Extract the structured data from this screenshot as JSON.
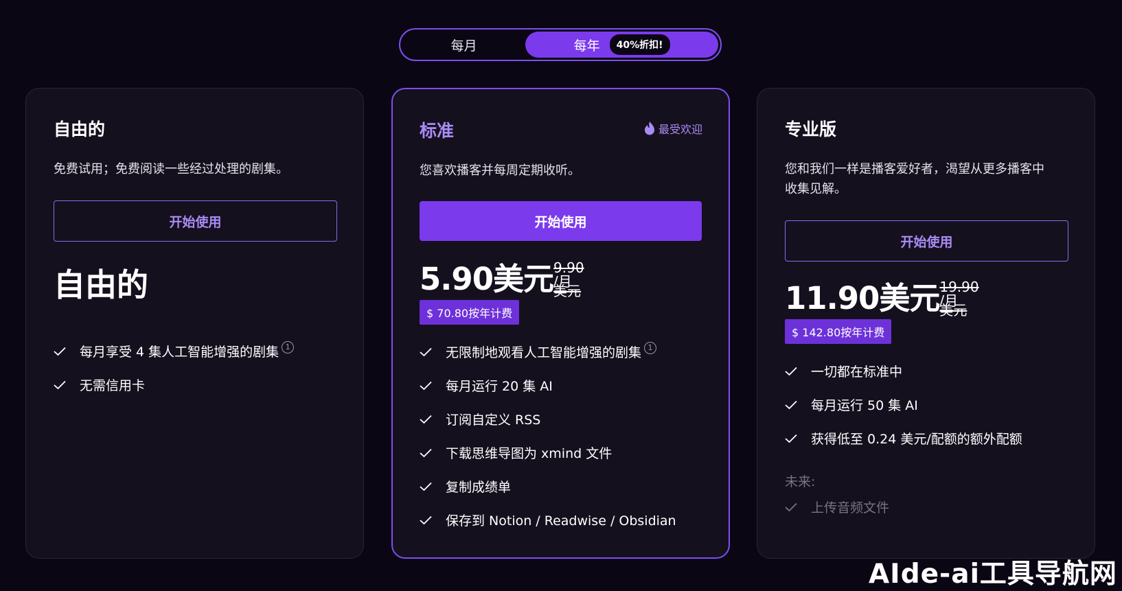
{
  "toggle": {
    "monthly_label": "每月",
    "yearly_label": "每年",
    "discount_badge": "40%折扣!"
  },
  "plans": [
    {
      "name": "自由的",
      "description": "免费试用；免费阅读一些经过处理的剧集。",
      "button_label": "开始使用",
      "price_text": "自由的",
      "features": [
        "每月享受 4 集人工智能增强的剧集",
        "无需信用卡"
      ]
    },
    {
      "name": "标准",
      "popular_label": "最受欢迎",
      "description": "您喜欢播客并每周定期收听。",
      "button_label": "开始使用",
      "price": "5.90美元",
      "old_price": "9.90",
      "per_month": "/月",
      "old_unit": "美元",
      "billed_yearly": "$ 70.80按年计费",
      "features": [
        "无限制地观看人工智能增强的剧集",
        "每月运行 20 集 AI",
        "订阅自定义 RSS",
        "下载思维导图为 xmind 文件",
        "复制成绩单",
        "保存到 Notion / Readwise / Obsidian"
      ]
    },
    {
      "name": "专业版",
      "description_line1": "您和我们一样是播客爱好者，渴望从更多播客中",
      "description_line2": "收集见解。",
      "button_label": "开始使用",
      "price": "11.90美元",
      "old_price": "19.90",
      "per_month": "/月",
      "old_unit": "美元",
      "billed_yearly": "$ 142.80按年计费",
      "features": [
        "一切都在标准中",
        "每月运行 50 集 AI",
        "获得低至 0.24 美元/配额的额外配额"
      ],
      "future_label": "未来:",
      "future_features": [
        "上传音频文件"
      ]
    }
  ],
  "info_glyph": "1",
  "watermark": "AIde-ai工具导航网",
  "colors": {
    "background": "#0b0614",
    "card": "#15101e",
    "accent": "#7c3aed",
    "accent_text": "#a98bf5",
    "muted_text": "#77737f"
  }
}
